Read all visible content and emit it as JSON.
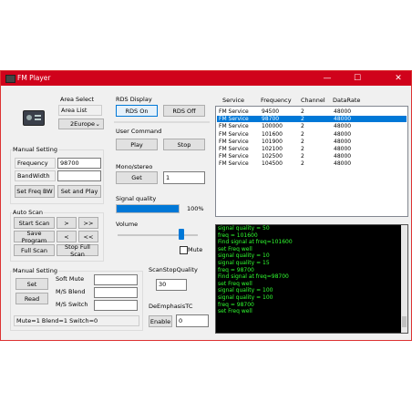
{
  "window": {
    "title": "FM Player",
    "minimize": "—",
    "maximize": "☐",
    "close": "✕"
  },
  "area": {
    "heading": "Area Select",
    "list_value": "Area List",
    "selected": "2Europe"
  },
  "rds": {
    "heading": "RDS Display",
    "on": "RDS On",
    "off": "RDS Off"
  },
  "user_command": {
    "heading": "User Command",
    "play": "Play",
    "stop": "Stop"
  },
  "mono": {
    "heading": "Mono/stereo",
    "get": "Get",
    "value": "1"
  },
  "signal": {
    "heading": "Signal quality",
    "percent_text": "100%",
    "level": 100
  },
  "volume": {
    "heading": "Volume",
    "mute": "Mute",
    "level": 80
  },
  "manual1": {
    "heading": "Manual Setting",
    "freq_label": "Frequency",
    "freq_value": "98700",
    "bw_label": "BandWidth",
    "bw_value": "",
    "set_bw": "Set Freq BW",
    "set_play": "Set and Play"
  },
  "autoscan": {
    "heading": "Auto Scan",
    "start": "Start Scan",
    "next": ">",
    "fnext": ">>",
    "save": "Save Program",
    "prev": "<",
    "fprev": "<<",
    "full": "Full Scan",
    "stop_full": "Stop Full Scan"
  },
  "manual2": {
    "heading": "Manual Setting",
    "set": "Set",
    "read": "Read",
    "soft_mute": "Soft Mute",
    "ms_blend": "M/S Blend",
    "ms_switch": "M/S Switch",
    "status": "Mute=1  Blend=1  Switch=0"
  },
  "scanstop": {
    "heading": "ScanStopQuality",
    "value": "30"
  },
  "deemph": {
    "heading": "DeEmphasisTC",
    "enable": "Enable",
    "value": "0"
  },
  "services": {
    "headers": [
      "Service",
      "Frequency",
      "Channel",
      "DataRate"
    ],
    "rows": [
      [
        "FM Service",
        "94500",
        "2",
        "48000"
      ],
      [
        "FM Service",
        "98700",
        "2",
        "48000"
      ],
      [
        "FM Service",
        "100000",
        "2",
        "48000"
      ],
      [
        "FM Service",
        "101600",
        "2",
        "48000"
      ],
      [
        "FM Service",
        "101900",
        "2",
        "48000"
      ],
      [
        "FM Service",
        "102100",
        "2",
        "48000"
      ],
      [
        "FM Service",
        "102500",
        "2",
        "48000"
      ],
      [
        "FM Service",
        "104500",
        "2",
        "48000"
      ]
    ]
  },
  "log": [
    "signal quality = 50",
    "freq = 101600",
    "Find signal at freq=101600",
    "set Freq well",
    "signal quality = 10",
    "signal quality = 15",
    "freq = 98700",
    "Find signal at freq=98700",
    "set Freq well",
    "signal quality = 100",
    "signal quality = 100",
    "freq = 98700",
    "set Freq well"
  ]
}
